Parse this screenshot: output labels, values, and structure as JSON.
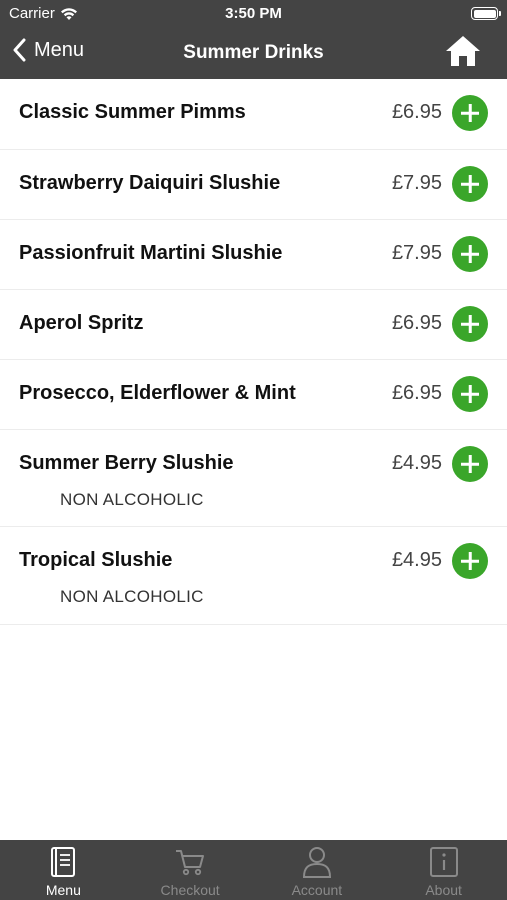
{
  "status_bar": {
    "carrier": "Carrier",
    "time": "3:50 PM"
  },
  "nav": {
    "back_label": "Menu",
    "title": "Summer Drinks"
  },
  "items": [
    {
      "name": "Classic Summer Pimms",
      "price": "£6.95"
    },
    {
      "name": "Strawberry Daiquiri Slushie",
      "price": "£7.95"
    },
    {
      "name": "Passionfruit Martini Slushie",
      "price": "£7.95"
    },
    {
      "name": "Aperol Spritz",
      "price": "£6.95"
    },
    {
      "name": "Prosecco, Elderflower & Mint",
      "price": "£6.95"
    },
    {
      "name": "Summer Berry Slushie",
      "price": "£4.95",
      "note": "NON ALCOHOLIC"
    },
    {
      "name": "Tropical Slushie",
      "price": "£4.95",
      "note": "NON ALCOHOLIC"
    }
  ],
  "tabs": [
    {
      "label": "Menu",
      "icon": "menu-book-icon",
      "active": true
    },
    {
      "label": "Checkout",
      "icon": "cart-icon",
      "active": false
    },
    {
      "label": "Account",
      "icon": "person-icon",
      "active": false
    },
    {
      "label": "About",
      "icon": "info-icon",
      "active": false
    }
  ],
  "colors": {
    "header_bg": "#444444",
    "accent_green": "#3aa62a",
    "tab_inactive": "#8a8a8a"
  }
}
